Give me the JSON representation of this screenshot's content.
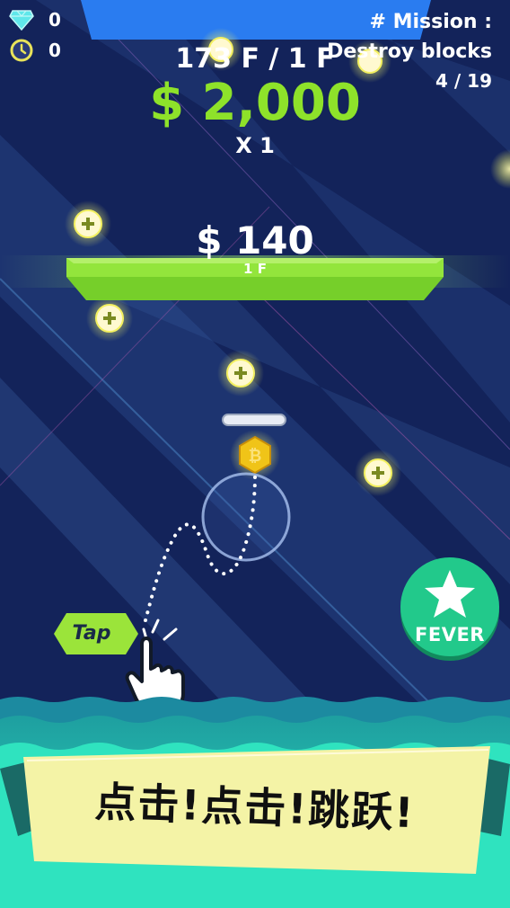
{
  "hud": {
    "diamond_count": "0",
    "timer_count": "0",
    "floor_progress": "173 F / 1 F",
    "money": "$ 2,000",
    "multiplier": "X 1"
  },
  "mission": {
    "title": "# Mission :",
    "task": "Destroy blocks",
    "progress": "4 / 19"
  },
  "platform": {
    "reward": "$ 140",
    "floor_label": "1 F"
  },
  "buttons": {
    "fever_label": "FEVER",
    "tap_label": "Tap"
  },
  "banner": {
    "text": "点击!点击!跳跃!"
  },
  "icons": {
    "diamond": "diamond-icon",
    "timer": "clock-icon",
    "coin": "bitcoin-coin-icon",
    "plus": "plus-orb-icon",
    "star": "star-icon",
    "hand": "pointing-hand-icon"
  },
  "colors": {
    "sky": "#13235a",
    "money_green": "#8ee22a",
    "platform_green": "#8fe23a",
    "fever_green": "#22c98b",
    "water": "#28d6b3",
    "banner_yellow": "#f4f3a6"
  }
}
